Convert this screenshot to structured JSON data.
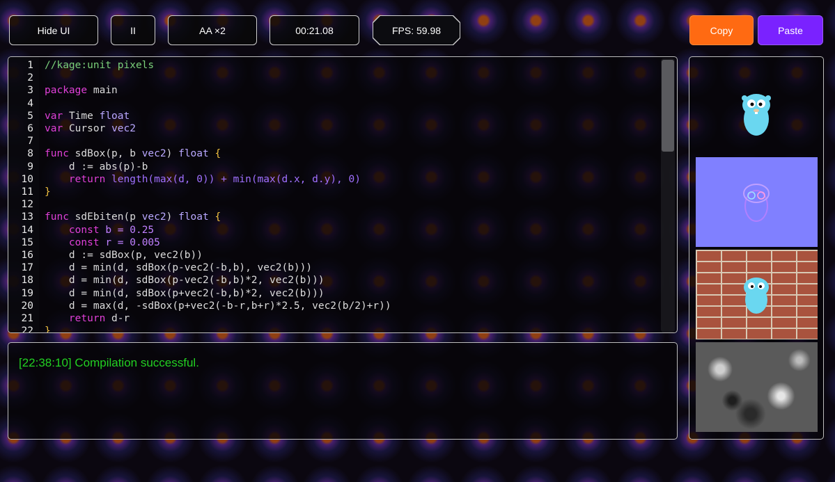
{
  "toolbar": {
    "hide_ui": "Hide UI",
    "pause_icon": "II",
    "aa": "AA ×2",
    "time": "00:21.08",
    "fps": "FPS: 59.98",
    "copy": "Copy",
    "paste": "Paste"
  },
  "console": {
    "message": "[22:38:10] Compilation successful."
  },
  "code": {
    "line_numbers": [
      "1",
      "2",
      "3",
      "4",
      "5",
      "6",
      "7",
      "8",
      "9",
      "10",
      "11",
      "12",
      "13",
      "14",
      "15",
      "16",
      "17",
      "18",
      "19",
      "20",
      "21",
      "22"
    ],
    "tokens": {
      "l1": "//kage:unit pixels",
      "package_kw": "package",
      "package_name": "main",
      "var_kw": "var",
      "time_name": "Time",
      "float_t": "float",
      "cursor_name": "Cursor",
      "vec2_t": "vec2",
      "func_kw": "func",
      "sdbox_sig": "sdBox(p, b",
      "sdebiten_sig": "sdEbiten(p",
      "brace_open": "{",
      "brace_close": "}",
      "l9": "    d := abs(p)-b",
      "return_kw": "return",
      "l10_rest": "length(max(d, 0)) + min(max(d.x, d.y), 0)",
      "const_kw": "const",
      "l14_rest": "b = 0.25",
      "l15_rest": "r = 0.005",
      "l16": "    d := sdBox(p, vec2(b))",
      "l17": "    d = min(d, sdBox(p-vec2(-b,b), vec2(b)))",
      "l18": "    d = min(d, sdBox(p-vec2(-b,b)*2, vec2(b)))",
      "l19": "    d = min(d, sdBox(p+vec2(-b,b)*2, vec2(b)))",
      "l20": "    d = max(d, -sdBox(p+vec2(-b-r,b+r)*2.5, vec2(b/2)+r))",
      "l21_rest": "d-r",
      "l22": "}"
    }
  },
  "colors": {
    "copy": "#ff6a12",
    "paste": "#7a22ff",
    "console_success": "#22d022"
  },
  "icons": {
    "pause": "pause-icon",
    "gopher": "gopher-icon"
  }
}
